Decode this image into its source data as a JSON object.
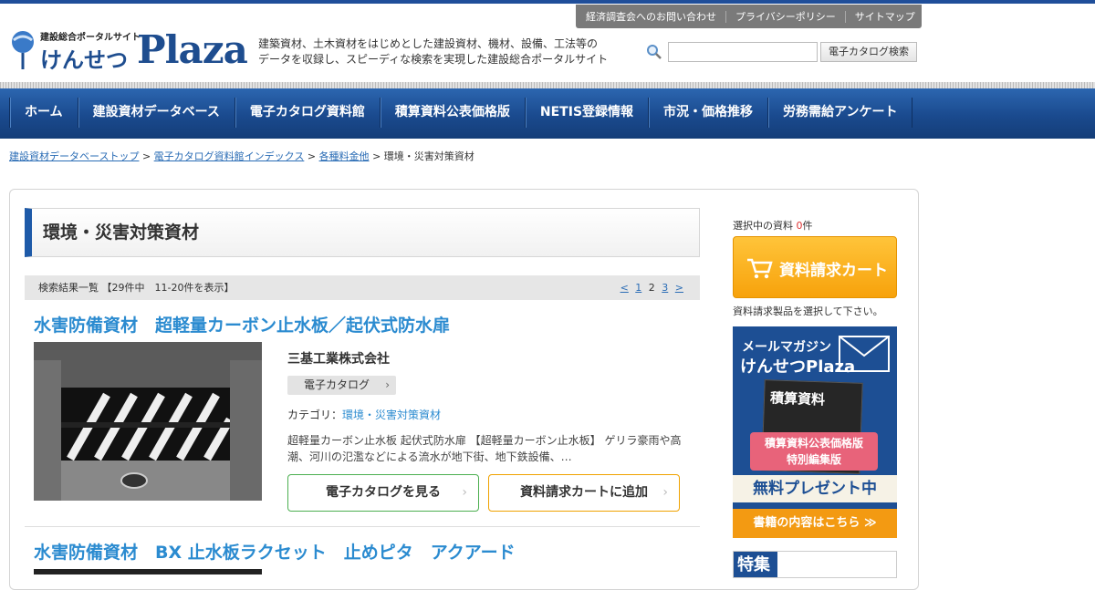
{
  "header": {
    "util_links": [
      "経済調査会へのお問い合わせ",
      "プライバシーポリシー",
      "サイトマップ"
    ],
    "logo_sub": "建設総合ポータルサイト",
    "logo_jp": "けんせつ",
    "logo_en": "Plaza",
    "description_line1": "建築資材、土木資材をはじめとした建設資材、機材、設備、工法等の",
    "description_line2": "データを収録し、スピーディな検索を実現した建設総合ポータルサイト",
    "search": {
      "placeholder": "",
      "button": "電子カタログ検索"
    }
  },
  "nav": [
    "ホーム",
    "建設資材データベース",
    "電子カタログ資料館",
    "積算資料公表価格版",
    "NETIS登録情報",
    "市況・価格推移",
    "労務需給アンケート"
  ],
  "breadcrumb": {
    "items": [
      "建設資材データベーストップ",
      "電子カタログ資料館インデックス",
      "各種料金他"
    ],
    "current": "環境・災害対策資材",
    "sep": ">"
  },
  "page_title": "環境・災害対策資材",
  "results": {
    "summary": "検索結果一覧 【29件中　11-20件を表示】",
    "pager": {
      "prev": "<",
      "pages": [
        "1",
        "2",
        "3"
      ],
      "current": "2",
      "next": ">"
    }
  },
  "items": [
    {
      "title": "水害防備資材　超軽量カーボン止水板／起伏式防水扉",
      "maker": "三基工業株式会社",
      "tag": "電子カタログ",
      "category_label": "カテゴリ：",
      "category": "環境・災害対策資材",
      "snippet": "超軽量カーボン止水板 起伏式防水扉 【超軽量カーボン止水板】 ゲリラ豪雨や高潮、河川の氾濫などによる流水が地下街、地下鉄設備、…",
      "btn_catalog": "電子カタログを見る",
      "btn_cart": "資料請求カートに追加"
    },
    {
      "title": "水害防備資材　BX 止水板ラクセット　止めピタ　アクアード"
    }
  ],
  "sidebar": {
    "selected_prefix": "選択中の資料 ",
    "selected_count": "0",
    "selected_suffix": "件",
    "cart_label": "資料請求カート",
    "cart_note": "資料請求製品を選択して下さい。",
    "banner": {
      "line1": "メールマガジン",
      "line2": "けんせつPlaza",
      "book_title": "積算資料",
      "pink_line1": "積算資料公表価格版",
      "pink_line2": "特別編集版",
      "free": "無料プレゼント中",
      "footer": "書籍の内容はこちら ≫"
    },
    "feature_label": "特集"
  },
  "colors": {
    "nav": "#1a4a8e",
    "accent": "#2b8bd0",
    "cart": "#f7a20b",
    "green": "#4caf50"
  }
}
